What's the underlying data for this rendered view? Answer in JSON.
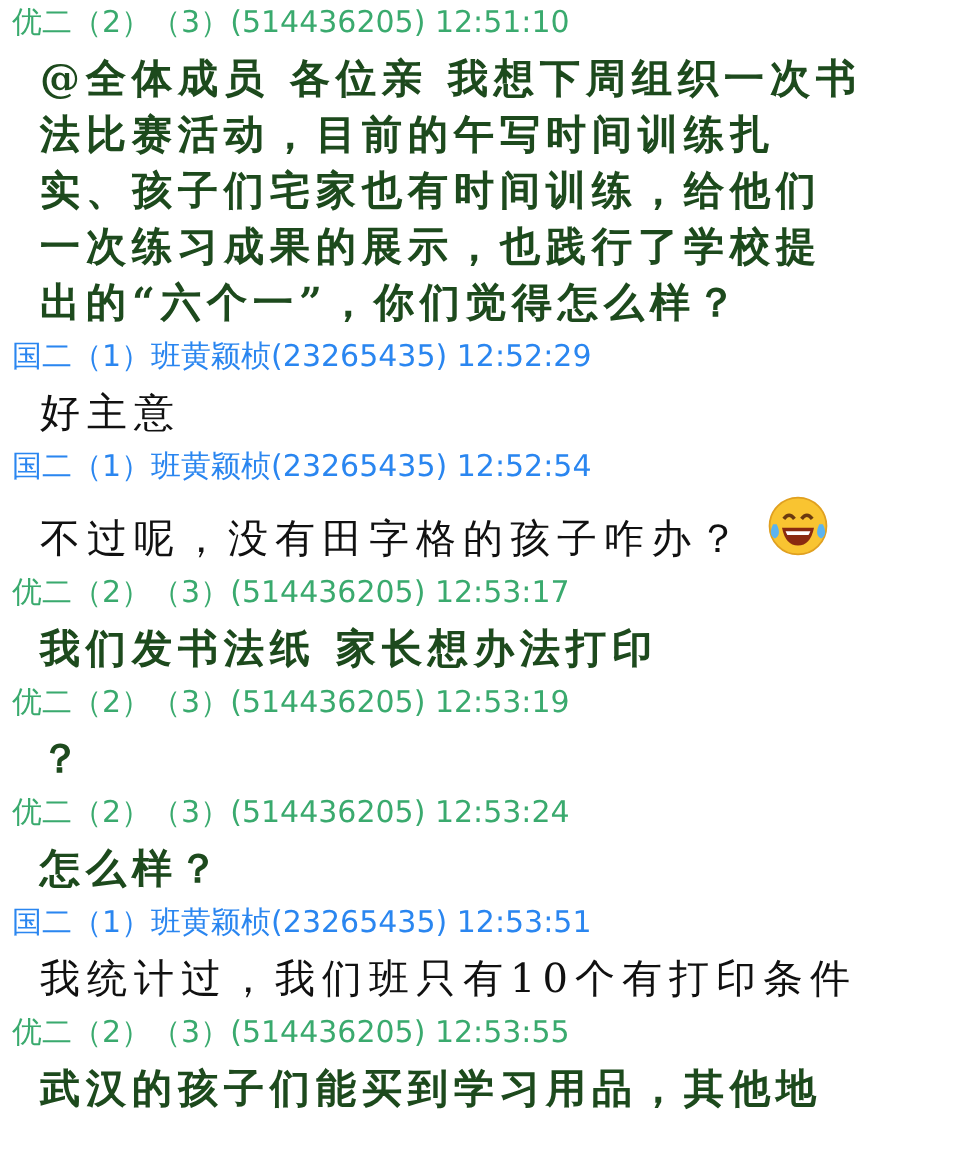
{
  "messages": [
    {
      "header": "优二（2）（3）(514436205) 12:51:10",
      "color": "#3aaa6e",
      "kind": "highlighted",
      "emoji": false,
      "lines": [
        "@全体成员 各位亲 我想下周组织一次书",
        "法比赛活动，目前的午写时间训练扎",
        "实、孩子们宅家也有时间训练，给他们",
        "一次练习成果的展示，也践行了学校提",
        "出的“六个一”，你们觉得怎么样？"
      ]
    },
    {
      "header": "国二（1）班黄颖桢(23265435) 12:52:29",
      "color": "#2a86f0",
      "kind": "plain",
      "emoji": false,
      "lines": [
        "好主意"
      ]
    },
    {
      "header": "国二（1）班黄颖桢(23265435) 12:52:54",
      "color": "#2a86f0",
      "kind": "plain",
      "emoji": true,
      "lines": [
        "不过呢，没有田字格的孩子咋办？"
      ]
    },
    {
      "header": "优二（2）（3）(514436205) 12:53:17",
      "color": "#3aaa6e",
      "kind": "highlighted",
      "emoji": false,
      "lines": [
        "我们发书法纸 家长想办法打印"
      ]
    },
    {
      "header": "优二（2）（3）(514436205) 12:53:19",
      "color": "#3aaa6e",
      "kind": "highlighted",
      "emoji": false,
      "lines": [
        "？"
      ]
    },
    {
      "header": "优二（2）（3）(514436205) 12:53:24",
      "color": "#3aaa6e",
      "kind": "highlighted",
      "emoji": false,
      "lines": [
        "怎么样？"
      ]
    },
    {
      "header": "国二（1）班黄颖桢(23265435) 12:53:51",
      "color": "#2a86f0",
      "kind": "plain",
      "emoji": false,
      "lines": [
        "我统计过，我们班只有10个有打印条件"
      ]
    },
    {
      "header": "优二（2）（3）(514436205) 12:53:55",
      "color": "#3aaa6e",
      "kind": "highlighted",
      "emoji": false,
      "lines": [
        "武汉的孩子们能买到学习用品，其他地"
      ]
    }
  ]
}
